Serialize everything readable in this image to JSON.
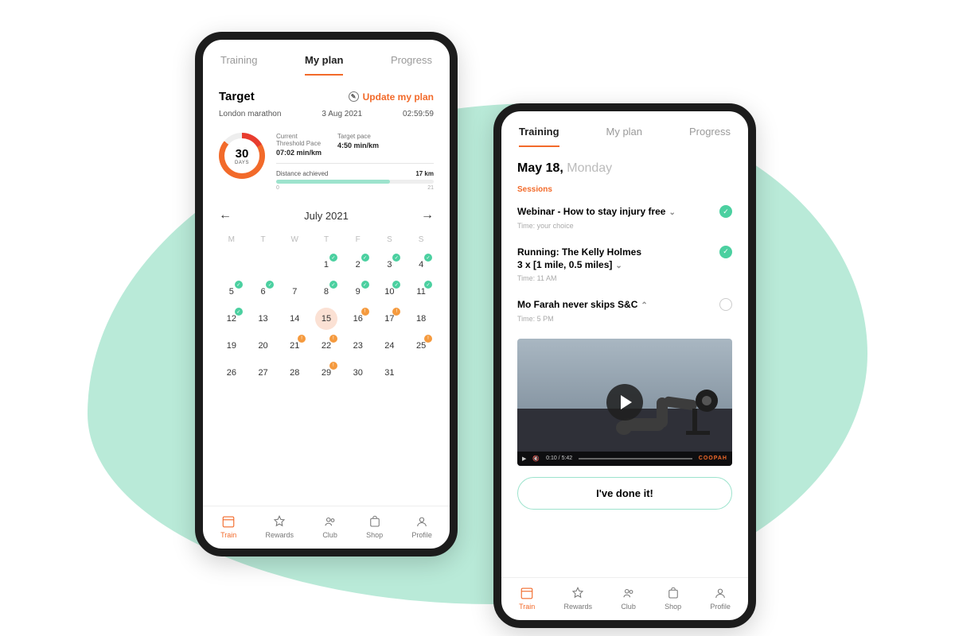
{
  "tabs": {
    "training": "Training",
    "myplan": "My plan",
    "progress": "Progress"
  },
  "left": {
    "target_label": "Target",
    "update_label": "Update my plan",
    "event": "London marathon",
    "event_date": "3 Aug 2021",
    "event_time": "02:59:59",
    "ring_value": "30",
    "ring_unit": "DAYS",
    "threshold_label": "Current\nThreshold Pace",
    "threshold_value": "07:02 min/km",
    "target_pace_label": "Target pace",
    "target_pace_value": "4:50 min/km",
    "distance_label": "Distance achieved",
    "distance_value": "17 km",
    "distance_min": "0",
    "distance_max": "21",
    "month": "July 2021",
    "dow": [
      "M",
      "T",
      "W",
      "T",
      "F",
      "S",
      "S"
    ],
    "days": [
      {
        "n": "",
        "b": ""
      },
      {
        "n": "",
        "b": ""
      },
      {
        "n": "",
        "b": ""
      },
      {
        "n": "1",
        "b": "done"
      },
      {
        "n": "2",
        "b": "done"
      },
      {
        "n": "3",
        "b": "done"
      },
      {
        "n": "4",
        "b": "done"
      },
      {
        "n": "5",
        "b": "done"
      },
      {
        "n": "6",
        "b": "done"
      },
      {
        "n": "7",
        "b": ""
      },
      {
        "n": "8",
        "b": "done"
      },
      {
        "n": "9",
        "b": "done"
      },
      {
        "n": "10",
        "b": "done"
      },
      {
        "n": "11",
        "b": "done"
      },
      {
        "n": "12",
        "b": "done"
      },
      {
        "n": "13",
        "b": ""
      },
      {
        "n": "14",
        "b": ""
      },
      {
        "n": "15",
        "b": "",
        "sel": true
      },
      {
        "n": "16",
        "b": "todo"
      },
      {
        "n": "17",
        "b": "todo"
      },
      {
        "n": "18",
        "b": ""
      },
      {
        "n": "19",
        "b": ""
      },
      {
        "n": "20",
        "b": ""
      },
      {
        "n": "21",
        "b": "todo"
      },
      {
        "n": "22",
        "b": "todo"
      },
      {
        "n": "23",
        "b": ""
      },
      {
        "n": "24",
        "b": ""
      },
      {
        "n": "25",
        "b": "todo"
      },
      {
        "n": "26",
        "b": ""
      },
      {
        "n": "27",
        "b": ""
      },
      {
        "n": "28",
        "b": ""
      },
      {
        "n": "29",
        "b": "todo"
      },
      {
        "n": "30",
        "b": ""
      },
      {
        "n": "31",
        "b": ""
      },
      {
        "n": "",
        "b": ""
      },
      {
        "n": "",
        "b": ""
      }
    ]
  },
  "right": {
    "date_strong": "May 18,",
    "date_weak": " Monday",
    "sessions_label": "Sessions",
    "sessions": [
      {
        "title": "Webinar - How to stay injury free",
        "time": "Time: your choice",
        "done": true,
        "expand": "down"
      },
      {
        "title": "Running: The Kelly Holmes\n3 x [1 mile, 0.5 miles]",
        "time": "Time: 11 AM",
        "done": true,
        "expand": "down"
      },
      {
        "title": "Mo Farah never skips S&C",
        "time": "Time: 5 PM",
        "done": false,
        "expand": "up"
      }
    ],
    "video_time": "0:10 / 5:42",
    "video_brand": "COOPAH",
    "cta": "I've done it!"
  },
  "nav": [
    {
      "label": "Train",
      "icon": "calendar"
    },
    {
      "label": "Rewards",
      "icon": "star"
    },
    {
      "label": "Club",
      "icon": "people"
    },
    {
      "label": "Shop",
      "icon": "bag"
    },
    {
      "label": "Profile",
      "icon": "person"
    }
  ]
}
